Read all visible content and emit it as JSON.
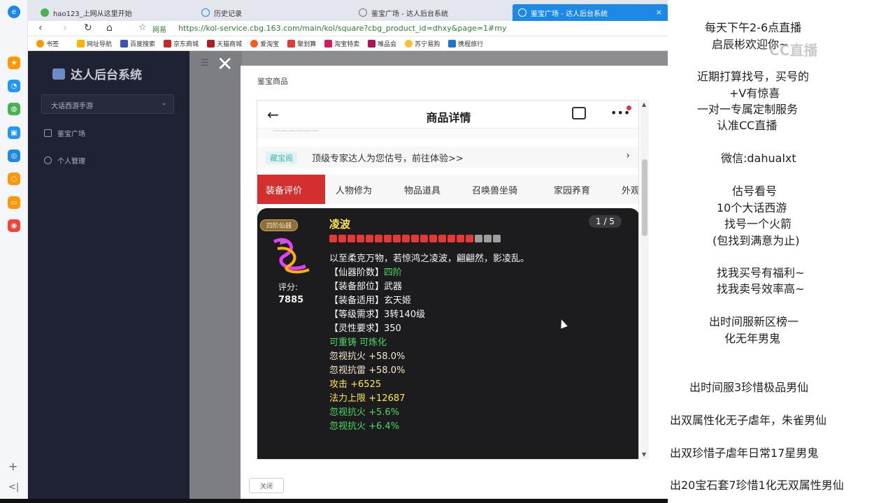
{
  "browser": {
    "tabs": [
      {
        "label": "hao123_上网从这里开始"
      },
      {
        "label": "历史记录"
      },
      {
        "label": "鉴宝广场 - 达人后台系统"
      },
      {
        "label": "鉴宝广场 - 达人后台系统"
      }
    ],
    "tab_close": "×",
    "url_label": "网易",
    "url": "https://kol-service.cbg.163.com/main/kol/square?cbg_product_id=dhxy&page=1#my",
    "bookmarks": [
      "书签",
      "网址导航",
      "百度搜索",
      "京东商城",
      "天猫商城",
      "爱淘宝",
      "聚划算",
      "淘宝特卖",
      "唯品会",
      "苏宁易购",
      "携程旅行"
    ]
  },
  "app": {
    "logo_title": "达人后台系统",
    "game_select": "大话西游手游",
    "menu": [
      "鉴宝广场",
      "个人管理"
    ]
  },
  "drawer": {
    "title": "鉴宝商品",
    "close_button": "关闭"
  },
  "phone": {
    "title": "商品详情",
    "promo_tag": "藏宝阁",
    "promo_text": "顶级专家达人为您估号，前往体验>>",
    "tabs": [
      "装备评价",
      "人物修为",
      "物品道具",
      "召唤兽坐骑",
      "家园养育",
      "外观"
    ]
  },
  "item": {
    "rank_badge": "四阶仙器",
    "name": "凌波",
    "pager": "1 / 5",
    "score_label": "评分:",
    "score_value": "7885",
    "stars_on": 16,
    "stars_total": 19,
    "desc": "以至柔克万物，若惊鸿之凌波，翩翩然，影凌乱。",
    "rank_key": "【仙器阶数】",
    "rank_value": "四阶",
    "slot": "【装备部位】武器",
    "fit": "【装备适用】玄天姬",
    "level": "【等级需求】3转140级",
    "spirit": "【灵性要求】350",
    "reforge": "可重铸 可炼化",
    "attrs": [
      {
        "text": "忽视抗火 +58.0%",
        "color": "white"
      },
      {
        "text": "忽视抗雷 +58.0%",
        "color": "white"
      },
      {
        "text": "攻击 +6525",
        "color": "yellow"
      },
      {
        "text": "法力上限 +12687",
        "color": "yellow"
      },
      {
        "text": "忽视抗火 +5.6%",
        "color": "green"
      },
      {
        "text": "忽视抗火 +6.4%",
        "color": "green"
      }
    ]
  },
  "notes": [
    "每天下午2-6点直播",
    "启辰彬欢迎你~",
    "近期打算找号，买号的",
    "+V有惊喜",
    "一对一专属定制服务",
    "认准CC直播",
    "微信:dahualxt",
    "估号看号",
    "10个大话西游",
    "找号一个火箭",
    "(包找到满意为止)",
    "找我买号有福利~",
    "找我卖号效率高~",
    "出时间服新区榜一",
    "化无年男鬼",
    "出时间服3珍惜极品男仙",
    "出双属性化无子虐年，朱雀男仙",
    "出双珍惜子虐年日常17星男鬼",
    "出20宝石套7珍惜1化无双属性男仙"
  ],
  "watermark": "CC直播"
}
